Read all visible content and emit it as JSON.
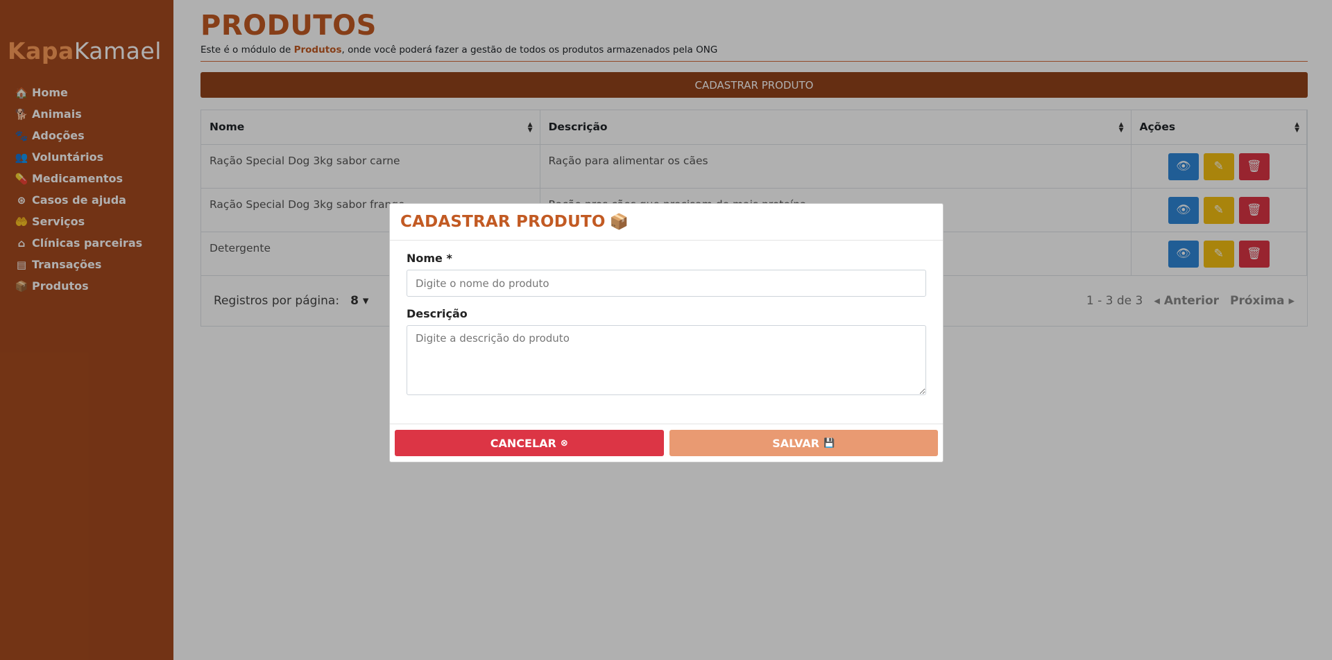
{
  "brand": {
    "part1": "Kapa",
    "part2": "Kamael"
  },
  "sidebar": {
    "items": [
      {
        "label": "Home",
        "icon": "🏠"
      },
      {
        "label": "Animais",
        "icon": "🐕"
      },
      {
        "label": "Adoções",
        "icon": "🐾"
      },
      {
        "label": "Voluntários",
        "icon": "👥"
      },
      {
        "label": "Medicamentos",
        "icon": "💊"
      },
      {
        "label": "Casos de ajuda",
        "icon": "⊛"
      },
      {
        "label": "Serviços",
        "icon": "🤲"
      },
      {
        "label": "Clínicas parceiras",
        "icon": "⌂"
      },
      {
        "label": "Transações",
        "icon": "▤"
      },
      {
        "label": "Produtos",
        "icon": "📦"
      }
    ]
  },
  "page": {
    "title": "PRODUTOS",
    "subtitle_pre": "Este é o módulo de ",
    "subtitle_bold": "Produtos",
    "subtitle_post": ", onde você poderá fazer a gestão de todos os produtos armazenados pela ONG",
    "cadastrar_button": "CADASTRAR PRODUTO"
  },
  "table": {
    "headers": [
      "Nome",
      "Descrição",
      "Ações"
    ],
    "rows": [
      {
        "nome": "Ração Special Dog 3kg sabor carne",
        "descricao": "Ração para alimentar os cães"
      },
      {
        "nome": "Ração Special Dog 3kg sabor frango",
        "descricao": "Ração pros cães que precisam de mais proteína"
      },
      {
        "nome": "Detergente",
        "descricao": ""
      }
    ],
    "pager": {
      "rpp_label": "Registros por página:",
      "rpp_value": "8",
      "range": "1 - 3 de 3",
      "prev": "Anterior",
      "next": "Próxima"
    }
  },
  "modal": {
    "title": "CADASTRAR PRODUTO",
    "nome_label": "Nome *",
    "nome_placeholder": "Digite o nome do produto",
    "descricao_label": "Descrição",
    "descricao_placeholder": "Digite a descrição do produto",
    "cancel_label": "CANCELAR",
    "save_label": "SALVAR"
  },
  "colors": {
    "sidebar": "#a64b1f",
    "accent": "#c25a23",
    "primary_button": "#93431b",
    "danger": "#dc3545",
    "warning": "#f5c012",
    "info": "#2f87d8"
  }
}
